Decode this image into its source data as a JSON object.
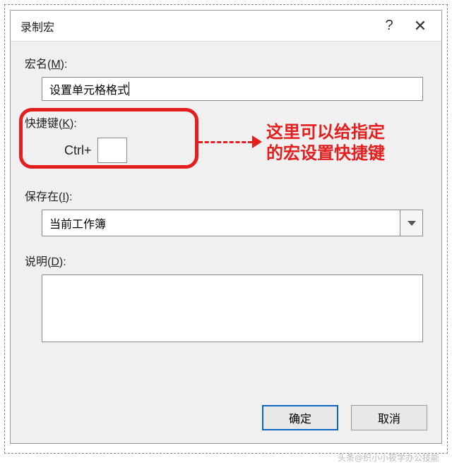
{
  "dialog": {
    "title": "录制宏",
    "help_symbol": "?",
    "close_symbol": "✕"
  },
  "macro_name": {
    "label_prefix": "宏名(",
    "label_key": "M",
    "label_suffix": "):",
    "value": "设置单元格格式"
  },
  "shortcut": {
    "label_prefix": "快捷键(",
    "label_key": "K",
    "label_suffix": "):",
    "ctrl_text": "Ctrl+",
    "key_value": ""
  },
  "annotation": {
    "line1": "这里可以给指定",
    "line2": "的宏设置快捷键"
  },
  "save_in": {
    "label_prefix": "保存在(",
    "label_key": "I",
    "label_suffix": "):",
    "selected": "当前工作簿"
  },
  "description": {
    "label_prefix": "说明(",
    "label_key": "D",
    "label_suffix": "):",
    "value": ""
  },
  "buttons": {
    "ok": "确定",
    "cancel": "取消"
  },
  "watermark": "头条@织小小筱学办公技能"
}
